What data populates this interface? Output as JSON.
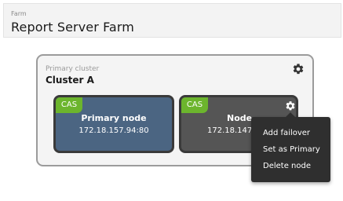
{
  "header": {
    "kicker": "Farm",
    "title": "Report Server Farm"
  },
  "cluster": {
    "kicker": "Primary cluster",
    "title": "Cluster A",
    "gear_icon": "gear-icon"
  },
  "nodes": [
    {
      "badge": "CAS",
      "name": "Primary node",
      "address": "172.18.157.94:80",
      "color": "#4b6582"
    },
    {
      "badge": "CAS",
      "name": "Node",
      "address": "172.18.147.",
      "color": "#555555",
      "gear_icon": "gear-icon"
    }
  ],
  "menu": {
    "items": [
      "Add failover",
      "Set as Primary",
      "Delete node"
    ]
  },
  "colors": {
    "badge": "#6cb52d",
    "menu_bg": "#2f2f2f",
    "cluster_border": "#9b9b9b"
  }
}
